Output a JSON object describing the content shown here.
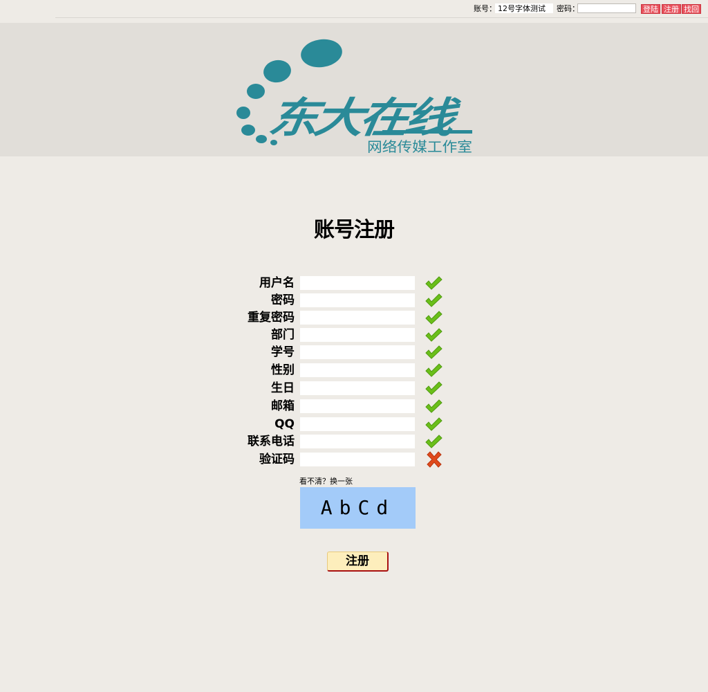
{
  "topbar": {
    "account_label": "账号：",
    "account_value": "12号字体测试",
    "password_label": "密码：",
    "password_value": "",
    "login_button": "登陆",
    "register_button": "注册",
    "recover_button": "找回"
  },
  "logo": {
    "name": "东大在线",
    "subtitle": "网络传媒工作室"
  },
  "page_title": "账号注册",
  "form": {
    "fields": [
      {
        "label": "用户名",
        "value": "",
        "status": "check-icon"
      },
      {
        "label": "密码",
        "value": "",
        "status": "check-icon"
      },
      {
        "label": "重复密码",
        "value": "",
        "status": "check-icon"
      },
      {
        "label": "部门",
        "value": "",
        "status": "check-icon"
      },
      {
        "label": "学号",
        "value": "",
        "status": "check-icon"
      },
      {
        "label": "性别",
        "value": "",
        "status": "check-icon"
      },
      {
        "label": "生日",
        "value": "",
        "status": "check-icon"
      },
      {
        "label": "邮箱",
        "value": "",
        "status": "check-icon"
      },
      {
        "label": "QQ",
        "value": "",
        "status": "check-icon"
      },
      {
        "label": "联系电话",
        "value": "",
        "status": "check-icon"
      },
      {
        "label": "验证码",
        "value": "",
        "status": "cross-icon"
      }
    ],
    "captcha_hint": "看不清？换一张",
    "captcha_text": "AbCd",
    "submit_label": "注册"
  },
  "colors": {
    "background": "#eeebe6",
    "banner": "#e1ded9",
    "logo_teal": "#2a8a98",
    "button_red": "#e8505b",
    "captcha_bg": "#a3cbf9",
    "submit_bg": "#fdeebc",
    "check_green": "#6bbf1a",
    "cross_red": "#e04a1c"
  }
}
